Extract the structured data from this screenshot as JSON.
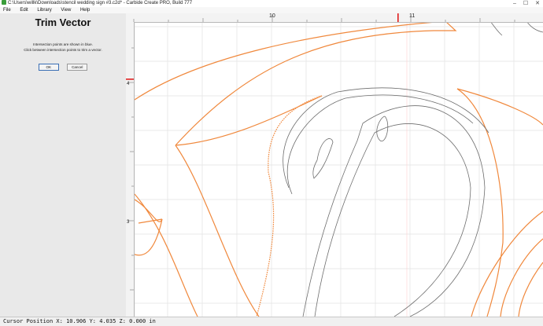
{
  "window": {
    "title": "C:\\Users\\willk\\Downloads\\stencil wedding sign #3.c2d* - Carbide Create PRO, Build 777",
    "minimize_glyph": "–",
    "maximize_glyph": "☐",
    "close_glyph": "✕"
  },
  "menu": {
    "file": "File",
    "edit": "Edit",
    "library": "Library",
    "view": "View",
    "help": "Help"
  },
  "panel": {
    "title": "Trim Vector",
    "line1": "Intersection points are shown in blue.",
    "line2": "Click between intersection points to trim a vector.",
    "ok_label": "OK",
    "cancel_label": "Cancel"
  },
  "rulers": {
    "top_10": "10",
    "top_11": "11",
    "left_4": "4",
    "left_3": "3"
  },
  "status": {
    "cursor_position": "Cursor Position X: 10.906 Y: 4.035 Z: 0.000 in"
  },
  "colors": {
    "vector_orange": "#f0883c",
    "vector_gray": "#6e6e6e",
    "grid": "#e2e2e2",
    "ruler_marker": "#e01e1e"
  }
}
